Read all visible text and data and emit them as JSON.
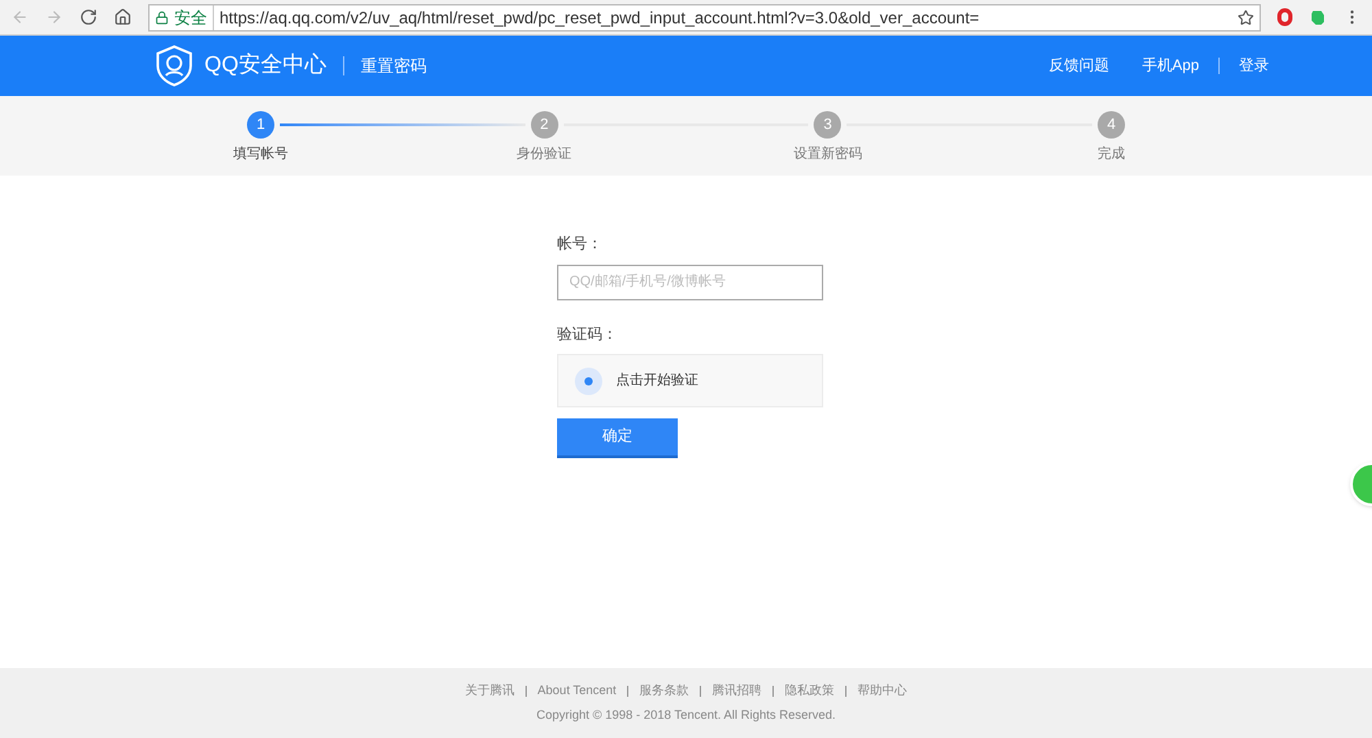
{
  "browser": {
    "secure_label": "安全",
    "url": "https://aq.qq.com/v2/uv_aq/html/reset_pwd/pc_reset_pwd_input_account.html?v=3.0&old_ver_account="
  },
  "header": {
    "logo": "QQ安全中心",
    "subtitle": "重置密码",
    "links": [
      "反馈问题",
      "手机App",
      "登录"
    ]
  },
  "steps": [
    {
      "number": "1",
      "label": "填写帐号",
      "selected": true
    },
    {
      "number": "2",
      "label": "身份验证",
      "selected": false
    },
    {
      "number": "3",
      "label": "设置新密码",
      "selected": false
    },
    {
      "number": "4",
      "label": "完成",
      "selected": false
    }
  ],
  "form": {
    "account_label": "帐号：",
    "account_placeholder": "QQ/邮箱/手机号/微博帐号",
    "captcha_label": "验证码：",
    "captcha_button": "点击开始验证",
    "submit": "确定"
  },
  "footer": {
    "links": [
      "关于腾讯",
      "About Tencent",
      "服务条款",
      "腾讯招聘",
      "隐私政策",
      "帮助中心"
    ],
    "copyright": "Copyright © 1998 - 2018 Tencent. All Rights Reserved."
  }
}
